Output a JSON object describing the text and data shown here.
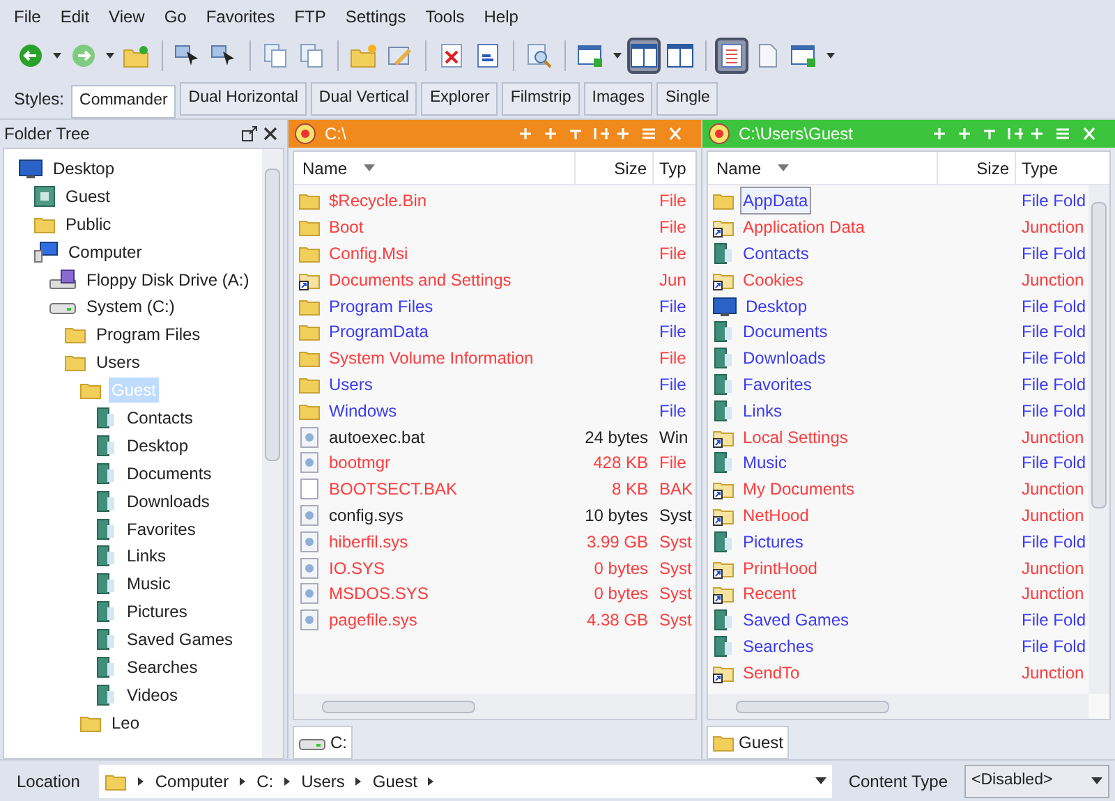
{
  "menu": [
    "File",
    "Edit",
    "View",
    "Go",
    "Favorites",
    "FTP",
    "Settings",
    "Tools",
    "Help"
  ],
  "toolbar": [
    {
      "kind": "back",
      "pressed": false
    },
    {
      "kind": "dropdown",
      "pressed": false
    },
    {
      "kind": "forward",
      "pressed": false
    },
    {
      "kind": "dropdown",
      "pressed": false
    },
    {
      "kind": "up",
      "pressed": false
    },
    {
      "kind": "sep"
    },
    {
      "kind": "select",
      "pressed": false
    },
    {
      "kind": "select",
      "pressed": false
    },
    {
      "kind": "sep"
    },
    {
      "kind": "copy",
      "pressed": false
    },
    {
      "kind": "copy",
      "pressed": false
    },
    {
      "kind": "sep"
    },
    {
      "kind": "newfolder",
      "pressed": false
    },
    {
      "kind": "edit",
      "pressed": false
    },
    {
      "kind": "sep"
    },
    {
      "kind": "delete",
      "pressed": false
    },
    {
      "kind": "props",
      "pressed": false
    },
    {
      "kind": "sep"
    },
    {
      "kind": "find",
      "pressed": false
    },
    {
      "kind": "sep"
    },
    {
      "kind": "window",
      "pressed": false
    },
    {
      "kind": "dropdown",
      "pressed": false
    },
    {
      "kind": "panes",
      "pressed": true
    },
    {
      "kind": "panes",
      "pressed": false
    },
    {
      "kind": "sep"
    },
    {
      "kind": "list",
      "pressed": true
    },
    {
      "kind": "page",
      "pressed": false
    },
    {
      "kind": "window",
      "pressed": false
    },
    {
      "kind": "dropdown",
      "pressed": false
    }
  ],
  "styles": {
    "label": "Styles:",
    "tabs": [
      {
        "label": "Commander",
        "selected": true
      },
      {
        "label": "Dual Horizontal",
        "selected": false
      },
      {
        "label": "Dual Vertical",
        "selected": false
      },
      {
        "label": "Explorer",
        "selected": false
      },
      {
        "label": "Filmstrip",
        "selected": false
      },
      {
        "label": "Images",
        "selected": false
      },
      {
        "label": "Single",
        "selected": false
      }
    ]
  },
  "folder_tree": {
    "title": "Folder Tree",
    "items": [
      {
        "label": "Desktop",
        "kind": "desktop",
        "selected": false,
        "children": [
          {
            "label": "Guest",
            "kind": "user",
            "selected": false
          },
          {
            "label": "Public",
            "kind": "folder",
            "selected": false
          },
          {
            "label": "Computer",
            "kind": "computer",
            "selected": false,
            "children": [
              {
                "label": "Floppy Disk Drive (A:)",
                "kind": "floppy",
                "selected": false
              },
              {
                "label": "System (C:)",
                "kind": "drive",
                "selected": false,
                "children": [
                  {
                    "label": "Program Files",
                    "kind": "folder",
                    "selected": false
                  },
                  {
                    "label": "Users",
                    "kind": "folder",
                    "selected": false,
                    "children": [
                      {
                        "label": "Guest",
                        "kind": "folder",
                        "selected": true,
                        "children": [
                          {
                            "label": "Contacts",
                            "kind": "special",
                            "selected": false
                          },
                          {
                            "label": "Desktop",
                            "kind": "special",
                            "selected": false
                          },
                          {
                            "label": "Documents",
                            "kind": "special",
                            "selected": false
                          },
                          {
                            "label": "Downloads",
                            "kind": "special",
                            "selected": false
                          },
                          {
                            "label": "Favorites",
                            "kind": "special",
                            "selected": false
                          },
                          {
                            "label": "Links",
                            "kind": "special",
                            "selected": false
                          },
                          {
                            "label": "Music",
                            "kind": "special",
                            "selected": false
                          },
                          {
                            "label": "Pictures",
                            "kind": "special",
                            "selected": false
                          },
                          {
                            "label": "Saved Games",
                            "kind": "special",
                            "selected": false
                          },
                          {
                            "label": "Searches",
                            "kind": "special",
                            "selected": false
                          },
                          {
                            "label": "Videos",
                            "kind": "special",
                            "selected": false
                          }
                        ]
                      },
                      {
                        "label": "Leo",
                        "kind": "folder",
                        "selected": false
                      }
                    ]
                  }
                ]
              }
            ]
          }
        ]
      }
    ]
  },
  "panes": [
    {
      "title": "C:\\",
      "color": "#f08a1c",
      "columns": [
        "Name",
        "Size",
        "Typ"
      ],
      "scroll": false,
      "tab": {
        "label": "C:",
        "kind": "drive"
      },
      "rows": [
        {
          "name": "$Recycle.Bin",
          "size": "",
          "type": "File",
          "kind": "folder",
          "color": "#ff3b3b",
          "selected": false
        },
        {
          "name": "Boot",
          "size": "",
          "type": "File",
          "kind": "folder",
          "color": "#ff3b3b",
          "selected": false
        },
        {
          "name": "Config.Msi",
          "size": "",
          "type": "File",
          "kind": "folder",
          "color": "#ff3b3b",
          "selected": false
        },
        {
          "name": "Documents and Settings",
          "size": "",
          "type": "Jun",
          "kind": "junction",
          "color": "#ff3b3b",
          "selected": false
        },
        {
          "name": "Program Files",
          "size": "",
          "type": "File",
          "kind": "folder",
          "color": "#3b3bf0",
          "selected": false
        },
        {
          "name": "ProgramData",
          "size": "",
          "type": "File",
          "kind": "folder",
          "color": "#3b3bf0",
          "selected": false
        },
        {
          "name": "System Volume Information",
          "size": "",
          "type": "File",
          "kind": "folder",
          "color": "#ff3b3b",
          "selected": false
        },
        {
          "name": "Users",
          "size": "",
          "type": "File",
          "kind": "folder",
          "color": "#3b3bf0",
          "selected": false
        },
        {
          "name": "Windows",
          "size": "",
          "type": "File",
          "kind": "folder",
          "color": "#3b3bf0",
          "selected": false
        },
        {
          "name": "autoexec.bat",
          "size": "24 bytes",
          "type": "Win",
          "kind": "sysfile",
          "color": "#222222",
          "selected": false
        },
        {
          "name": "bootmgr",
          "size": "428 KB",
          "type": "File",
          "kind": "sysfile",
          "color": "#ff3b3b",
          "selected": false
        },
        {
          "name": "BOOTSECT.BAK",
          "size": "8 KB",
          "type": "BAK",
          "kind": "file",
          "color": "#ff3b3b",
          "selected": false
        },
        {
          "name": "config.sys",
          "size": "10 bytes",
          "type": "Syst",
          "kind": "sysfile",
          "color": "#222222",
          "selected": false
        },
        {
          "name": "hiberfil.sys",
          "size": "3.99 GB",
          "type": "Syst",
          "kind": "sysfile",
          "color": "#ff3b3b",
          "selected": false
        },
        {
          "name": "IO.SYS",
          "size": "0 bytes",
          "type": "Syst",
          "kind": "sysfile",
          "color": "#ff3b3b",
          "selected": false
        },
        {
          "name": "MSDOS.SYS",
          "size": "0 bytes",
          "type": "Syst",
          "kind": "sysfile",
          "color": "#ff3b3b",
          "selected": false
        },
        {
          "name": "pagefile.sys",
          "size": "4.38 GB",
          "type": "Syst",
          "kind": "sysfile",
          "color": "#ff3b3b",
          "selected": false
        }
      ]
    },
    {
      "title": "C:\\Users\\Guest",
      "color": "#3cc43c",
      "columns": [
        "Name",
        "Size",
        "Type"
      ],
      "scroll": true,
      "tab": {
        "label": "Guest",
        "kind": "folder"
      },
      "rows": [
        {
          "name": "AppData",
          "size": "",
          "type": "File Fold",
          "kind": "folder",
          "color": "#3b3bf0",
          "selected": true
        },
        {
          "name": "Application Data",
          "size": "",
          "type": "Junction",
          "kind": "junction",
          "color": "#ff3b3b",
          "selected": false
        },
        {
          "name": "Contacts",
          "size": "",
          "type": "File Fold",
          "kind": "special",
          "color": "#3b3bf0",
          "selected": false
        },
        {
          "name": "Cookies",
          "size": "",
          "type": "Junction",
          "kind": "junction",
          "color": "#ff3b3b",
          "selected": false
        },
        {
          "name": "Desktop",
          "size": "",
          "type": "File Fold",
          "kind": "desktop",
          "color": "#3b3bf0",
          "selected": false
        },
        {
          "name": "Documents",
          "size": "",
          "type": "File Fold",
          "kind": "special",
          "color": "#3b3bf0",
          "selected": false
        },
        {
          "name": "Downloads",
          "size": "",
          "type": "File Fold",
          "kind": "special",
          "color": "#3b3bf0",
          "selected": false
        },
        {
          "name": "Favorites",
          "size": "",
          "type": "File Fold",
          "kind": "special",
          "color": "#3b3bf0",
          "selected": false
        },
        {
          "name": "Links",
          "size": "",
          "type": "File Fold",
          "kind": "special",
          "color": "#3b3bf0",
          "selected": false
        },
        {
          "name": "Local Settings",
          "size": "",
          "type": "Junction",
          "kind": "junction",
          "color": "#ff3b3b",
          "selected": false
        },
        {
          "name": "Music",
          "size": "",
          "type": "File Fold",
          "kind": "special",
          "color": "#3b3bf0",
          "selected": false
        },
        {
          "name": "My Documents",
          "size": "",
          "type": "Junction",
          "kind": "junction",
          "color": "#ff3b3b",
          "selected": false
        },
        {
          "name": "NetHood",
          "size": "",
          "type": "Junction",
          "kind": "junction",
          "color": "#ff3b3b",
          "selected": false
        },
        {
          "name": "Pictures",
          "size": "",
          "type": "File Fold",
          "kind": "special",
          "color": "#3b3bf0",
          "selected": false
        },
        {
          "name": "PrintHood",
          "size": "",
          "type": "Junction",
          "kind": "junction",
          "color": "#ff3b3b",
          "selected": false
        },
        {
          "name": "Recent",
          "size": "",
          "type": "Junction",
          "kind": "junction",
          "color": "#ff3b3b",
          "selected": false
        },
        {
          "name": "Saved Games",
          "size": "",
          "type": "File Fold",
          "kind": "special",
          "color": "#3b3bf0",
          "selected": false
        },
        {
          "name": "Searches",
          "size": "",
          "type": "File Fold",
          "kind": "special",
          "color": "#3b3bf0",
          "selected": false
        },
        {
          "name": "SendTo",
          "size": "",
          "type": "Junction",
          "kind": "junction",
          "color": "#ff3b3b",
          "selected": false
        }
      ]
    }
  ],
  "location": {
    "label": "Location",
    "crumbs": [
      "Computer",
      "C:",
      "Users",
      "Guest"
    ],
    "content_type_label": "Content Type",
    "content_type": "<Disabled>"
  }
}
